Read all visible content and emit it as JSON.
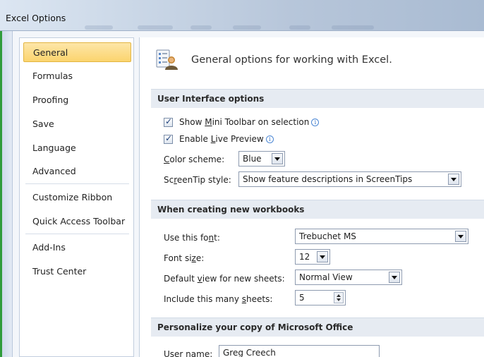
{
  "window": {
    "title": "Excel Options"
  },
  "nav": {
    "items": [
      {
        "label": "General"
      },
      {
        "label": "Formulas"
      },
      {
        "label": "Proofing"
      },
      {
        "label": "Save"
      },
      {
        "label": "Language"
      },
      {
        "label": "Advanced"
      },
      {
        "label": "Customize Ribbon"
      },
      {
        "label": "Quick Access Toolbar"
      },
      {
        "label": "Add-Ins"
      },
      {
        "label": "Trust Center"
      }
    ],
    "selected": "General"
  },
  "header": {
    "text": "General options for working with Excel."
  },
  "sections": {
    "ui": "User Interface options",
    "workbooks": "When creating new workbooks",
    "personalize": "Personalize your copy of Microsoft Office"
  },
  "ui_options": {
    "mini_toolbar": {
      "pre": "Show ",
      "accel": "M",
      "post": "ini Toolbar on selection",
      "checked": true
    },
    "live_preview": {
      "pre": "Enable ",
      "accel": "L",
      "post": "ive Preview",
      "checked": true
    },
    "color_scheme": {
      "pre": "",
      "accel": "C",
      "post": "olor scheme:",
      "value": "Blue"
    },
    "screentip": {
      "pre": "Sc",
      "accel": "r",
      "post": "eenTip style:",
      "value": "Show feature descriptions in ScreenTips"
    }
  },
  "workbooks": {
    "font": {
      "pre": "Use this fo",
      "accel": "n",
      "post": "t:",
      "value": "Trebuchet MS"
    },
    "font_size": {
      "pre": "Font si",
      "accel": "z",
      "post": "e:",
      "value": "12"
    },
    "default_view": {
      "pre": "Default ",
      "accel": "v",
      "post": "iew for new sheets:",
      "value": "Normal View"
    },
    "sheets": {
      "pre": "Include this many ",
      "accel": "s",
      "post": "heets:",
      "value": "5"
    }
  },
  "personalize": {
    "username_label": "User name:",
    "username_value": "Greg Creech"
  },
  "icons": {
    "info": "info-icon",
    "dropdown": "chevron-down-icon",
    "header": "options-gear-icon"
  },
  "colors": {
    "selected_nav_bg": "#fbd46e",
    "section_bg": "#e6ebf2",
    "accent_green": "#2f9c3a"
  }
}
